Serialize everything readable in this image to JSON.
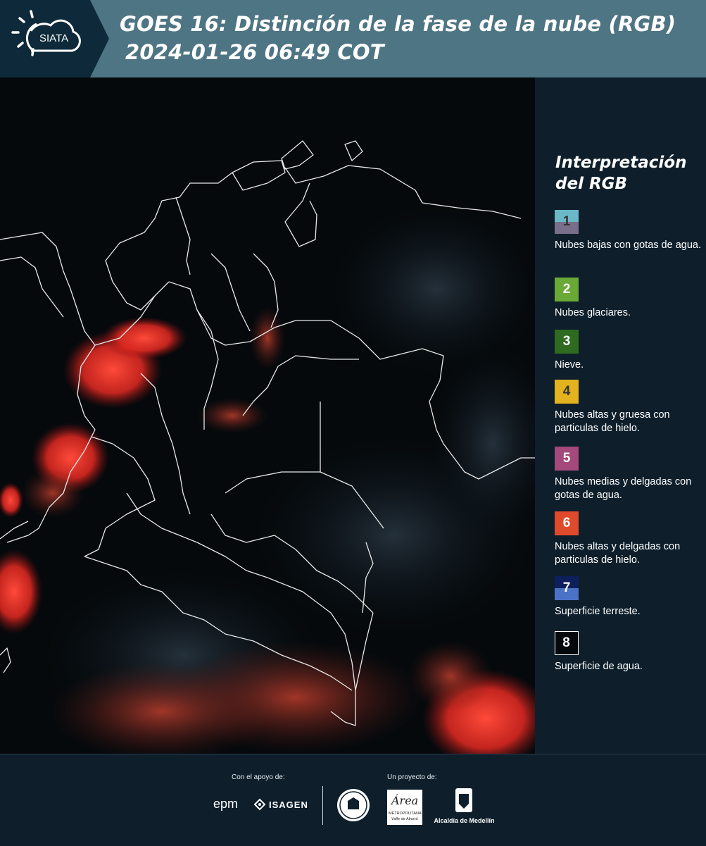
{
  "header": {
    "logo_text": "SIATA",
    "title_line1": "GOES 16: Distinción de la fase de la nube (RGB)",
    "title_line2": "2024-01-26 06:49 COT",
    "background": "#4e7584"
  },
  "map": {
    "description_icon": "satellite-rgb-image",
    "country": "Colombia"
  },
  "legend": {
    "title_line1": "Interpretación",
    "title_line2": "del RGB",
    "items": [
      {
        "num": "1",
        "label": "Nubes bajas con gotas de agua.",
        "color_top": "#6bb8c8",
        "color_bottom": "#7a6f8a",
        "num_color": "#333333"
      },
      {
        "num": "2",
        "label": "Nubes glaciares.",
        "color_top": "#6aa936",
        "color_bottom": "#6aa936",
        "num_color": "#ffffff"
      },
      {
        "num": "3",
        "label": "Nieve.",
        "color_top": "#2e6a1f",
        "color_bottom": "#2e6a1f",
        "num_color": "#ffffff"
      },
      {
        "num": "4",
        "label": "Nubes altas y gruesa con particulas de hielo.",
        "color_top": "#e3b21e",
        "color_bottom": "#e3b21e",
        "num_color": "#333333"
      },
      {
        "num": "5",
        "label": "Nubes medias y delgadas con gotas de agua.",
        "color_top": "#a5487c",
        "color_bottom": "#a5487c",
        "num_color": "#ffffff"
      },
      {
        "num": "6",
        "label": "Nubes altas y delgadas con particulas de hielo.",
        "color_top": "#e04a2c",
        "color_bottom": "#e04a2c",
        "num_color": "#ffffff"
      },
      {
        "num": "7",
        "label": "Superficie terreste.",
        "color_top": "#0d1f5c",
        "color_bottom": "#4a72c6",
        "num_color": "#ffffff"
      },
      {
        "num": "8",
        "label": "Superficie de agua.",
        "color_top": "#05090c",
        "color_bottom": "#05090c",
        "num_color": "#ffffff"
      }
    ]
  },
  "footer": {
    "support_label": "Con el apoyo de:",
    "project_label": "Un proyecto de:",
    "epm": "epm",
    "isagen": "ISAGEN",
    "area_name": "Área",
    "area_sub1": "METROPOLITANA",
    "area_sub2": "Valle de Aburrá",
    "alcaldia": "Alcaldía de Medellín"
  }
}
